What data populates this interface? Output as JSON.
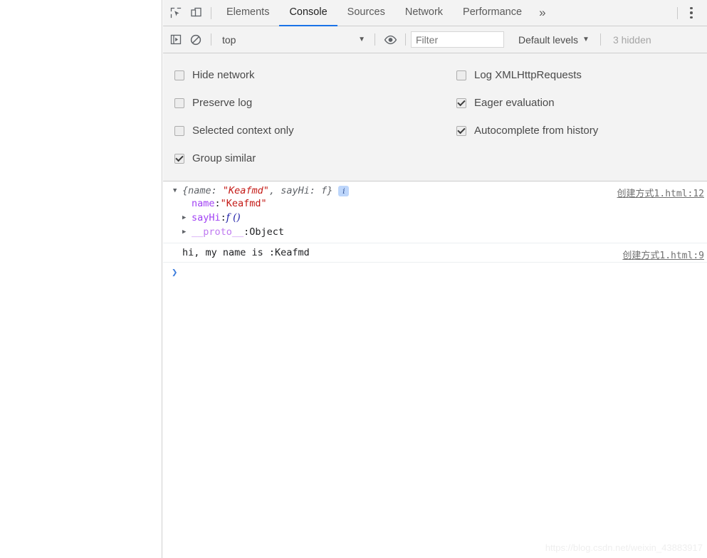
{
  "window": {
    "left_pane_label": "page-content-area"
  },
  "main_toolbar": {
    "inspect_icon": "inspect-cursor-icon",
    "device_icon": "device-toolbar-icon",
    "tabs": [
      {
        "label": "Elements",
        "active": false
      },
      {
        "label": "Console",
        "active": true
      },
      {
        "label": "Sources",
        "active": false
      },
      {
        "label": "Network",
        "active": false
      },
      {
        "label": "Performance",
        "active": false
      }
    ],
    "more_tabs_glyph": "»",
    "kebab_icon": "more-options-icon"
  },
  "filter_toolbar": {
    "sidebar_icon": "console-sidebar-icon",
    "clear_icon": "clear-console-icon",
    "context": "top",
    "context_caret": "▼",
    "eye_icon": "live-expression-icon",
    "filter_placeholder": "Filter",
    "filter_value": "",
    "levels_label": "Default levels",
    "levels_caret": "▼",
    "hidden_label": "3 hidden"
  },
  "settings": {
    "column_left": [
      {
        "label": "Hide network",
        "checked": false
      },
      {
        "label": "Preserve log",
        "checked": false
      },
      {
        "label": "Selected context only",
        "checked": false
      },
      {
        "label": "Group similar",
        "checked": true
      }
    ],
    "column_right": [
      {
        "label": "Log XMLHttpRequests",
        "checked": false
      },
      {
        "label": "Eager evaluation",
        "checked": true
      },
      {
        "label": "Autocomplete from history",
        "checked": true
      }
    ]
  },
  "console": {
    "object_message": {
      "toggle_glyph": "▼",
      "preview_open": "{name: ",
      "preview_string": "\"Keafmd\"",
      "preview_mid": ", sayHi: f}",
      "info_badge": "i",
      "source": "创建方式1.html:12",
      "properties": [
        {
          "disclosure": "",
          "name": "name",
          "separator": ": ",
          "value": "\"Keafmd\"",
          "value_kind": "string"
        },
        {
          "disclosure": "▶",
          "name": "sayHi",
          "separator": ": ",
          "value": "f ()",
          "value_kind": "function"
        },
        {
          "disclosure": "▶",
          "name": "__proto__",
          "separator": ": ",
          "value": "Object",
          "value_kind": "plain"
        }
      ]
    },
    "log_message": {
      "text": "hi, my name is :Keafmd",
      "source": "创建方式1.html:9"
    },
    "prompt": {
      "caret": "❯",
      "value": ""
    }
  },
  "watermark": {
    "text": "https://blog.csdn.net/weixin_43883917"
  },
  "colors": {
    "accent": "#1a73e8",
    "toolbar_bg": "#f3f3f3",
    "string_red": "#c41a16",
    "property_purple": "#a142f4",
    "proto_purple": "#bf7af0",
    "prompt_blue": "#3c7ddd",
    "info_badge_bg": "#bdd6fb"
  }
}
